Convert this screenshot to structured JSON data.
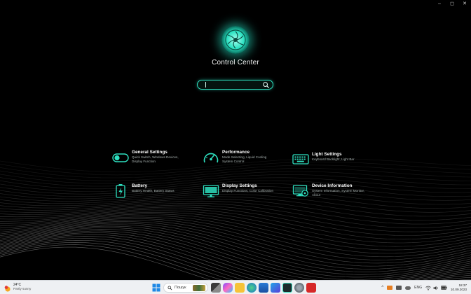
{
  "window": {
    "controls": {
      "minimize": "–",
      "maximize": "◻",
      "close": "✕"
    }
  },
  "app": {
    "title": "Control Center",
    "search": {
      "value": "",
      "placeholder": ""
    },
    "accent": "#2ee0c0"
  },
  "tiles": [
    {
      "name": "General Settings",
      "desc": "Quick Switch, Windows Devices, Display Function",
      "icon": "toggle-switch-icon"
    },
    {
      "name": "Performance",
      "desc": "Mode Selecting, Liquid Cooling System Control",
      "icon": "speedometer-icon"
    },
    {
      "name": "Light Settings",
      "desc": "Keyboard Backlight, Light Bar",
      "icon": "keyboard-icon"
    },
    {
      "name": "Battery",
      "desc": "Battery Health, Battery Status",
      "icon": "battery-icon"
    },
    {
      "name": "Display Settings",
      "desc": "Display Functions, Color Calibration",
      "icon": "monitor-icon"
    },
    {
      "name": "Device Information",
      "desc": "System Information, System Monitor, About",
      "icon": "device-info-icon"
    }
  ],
  "taskbar": {
    "weather": {
      "temp": "24°C",
      "condition": "Partly sunny",
      "badge": "1"
    },
    "search_label": "Пошук",
    "tray": {
      "chevron": "^",
      "language": "ENG"
    },
    "clock": {
      "time": "18:37",
      "date": "10.09.2023"
    }
  }
}
